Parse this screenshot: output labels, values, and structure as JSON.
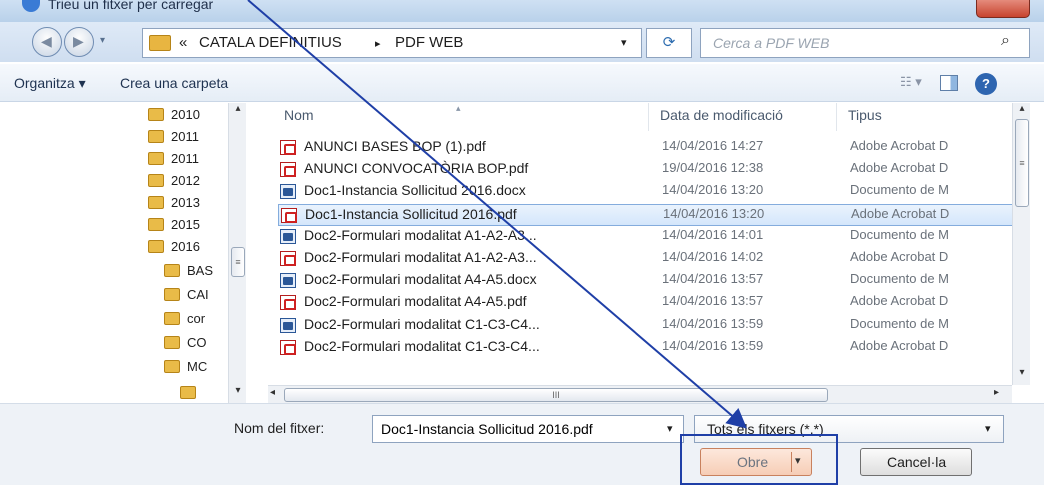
{
  "window": {
    "title": "Trieu un fitxer per carregar",
    "accent": "#1f3fa7"
  },
  "address": {
    "overflow": "«",
    "crumbs": [
      "CATALA DEFINITIUS",
      "PDF WEB"
    ],
    "separator": "▸",
    "dropdown": "▾",
    "refresh": "⟳",
    "search_placeholder": "Cerca a PDF WEB",
    "search_icon": "⌕"
  },
  "toolbar": {
    "organize": "Organitza ▾",
    "new_folder": "Crea una carpeta",
    "views": "☷ ▾",
    "help": "?"
  },
  "nav": {
    "items": [
      "2010",
      "2011",
      "2011",
      "2012",
      "2013",
      "2015",
      "2016",
      "BAS",
      "CAI",
      "cor",
      "CO",
      "MC"
    ]
  },
  "columns": {
    "name": "Nom",
    "date": "Data de modificació",
    "type": "Tipus"
  },
  "files": [
    {
      "name": "ANUNCI BASES BOP (1).pdf",
      "date": "14/04/2016 14:27",
      "type": "Adobe Acrobat D",
      "kind": "pdf"
    },
    {
      "name": "ANUNCI CONVOCATÒRIA BOP.pdf",
      "date": "19/04/2016 12:38",
      "type": "Adobe Acrobat D",
      "kind": "pdf"
    },
    {
      "name": "Doc1-Instancia Sollicitud 2016.docx",
      "date": "14/04/2016 13:20",
      "type": "Documento de M",
      "kind": "doc"
    },
    {
      "name": "Doc1-Instancia Sollicitud 2016.pdf",
      "date": "14/04/2016 13:20",
      "type": "Adobe Acrobat D",
      "kind": "pdf"
    },
    {
      "name": "Doc2-Formulari modalitat A1-A2-A3...",
      "date": "14/04/2016 14:01",
      "type": "Documento de M",
      "kind": "doc"
    },
    {
      "name": "Doc2-Formulari modalitat A1-A2-A3...",
      "date": "14/04/2016 14:02",
      "type": "Adobe Acrobat D",
      "kind": "pdf"
    },
    {
      "name": "Doc2-Formulari modalitat A4-A5.docx",
      "date": "14/04/2016 13:57",
      "type": "Documento de M",
      "kind": "doc"
    },
    {
      "name": "Doc2-Formulari modalitat A4-A5.pdf",
      "date": "14/04/2016 13:57",
      "type": "Adobe Acrobat D",
      "kind": "pdf"
    },
    {
      "name": "Doc2-Formulari modalitat C1-C3-C4...",
      "date": "14/04/2016 13:59",
      "type": "Documento de M",
      "kind": "doc"
    },
    {
      "name": "Doc2-Formulari modalitat C1-C3-C4...",
      "date": "14/04/2016 13:59",
      "type": "Adobe Acrobat D",
      "kind": "pdf"
    }
  ],
  "selected_row": 3,
  "scroll": {
    "up": "▴",
    "down": "▾",
    "left": "◂",
    "right": "▸",
    "grip_v": "≡",
    "grip_h": "III"
  },
  "bottom": {
    "filename_label": "Nom del fitxer:",
    "filename_value": "Doc1-Instancia Sollicitud 2016.pdf",
    "filetype": "Tots els fitxers (*.*)",
    "dropdown": "▾",
    "open": "Obre",
    "cancel": "Cancel·la"
  }
}
